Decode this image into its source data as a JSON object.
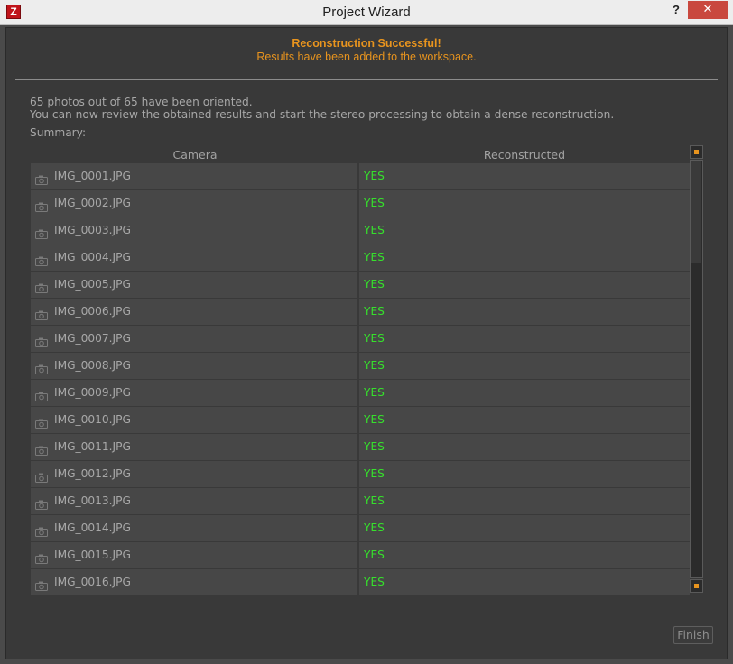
{
  "window": {
    "app_icon": "Z",
    "title": "Project Wizard",
    "help_label": "?",
    "close_label": "✕"
  },
  "header": {
    "title": "Reconstruction Successful!",
    "subtitle": "Results have been added to the workspace."
  },
  "info": {
    "line1": "65 photos out of 65 have been oriented.",
    "line2": "You can now review the obtained results and start the stereo processing to obtain a dense reconstruction.",
    "summary_label": "Summary:"
  },
  "table": {
    "columns": [
      "Camera",
      "Reconstructed"
    ],
    "rows": [
      {
        "camera": "IMG_0001.JPG",
        "reconstructed": "YES"
      },
      {
        "camera": "IMG_0002.JPG",
        "reconstructed": "YES"
      },
      {
        "camera": "IMG_0003.JPG",
        "reconstructed": "YES"
      },
      {
        "camera": "IMG_0004.JPG",
        "reconstructed": "YES"
      },
      {
        "camera": "IMG_0005.JPG",
        "reconstructed": "YES"
      },
      {
        "camera": "IMG_0006.JPG",
        "reconstructed": "YES"
      },
      {
        "camera": "IMG_0007.JPG",
        "reconstructed": "YES"
      },
      {
        "camera": "IMG_0008.JPG",
        "reconstructed": "YES"
      },
      {
        "camera": "IMG_0009.JPG",
        "reconstructed": "YES"
      },
      {
        "camera": "IMG_0010.JPG",
        "reconstructed": "YES"
      },
      {
        "camera": "IMG_0011.JPG",
        "reconstructed": "YES"
      },
      {
        "camera": "IMG_0012.JPG",
        "reconstructed": "YES"
      },
      {
        "camera": "IMG_0013.JPG",
        "reconstructed": "YES"
      },
      {
        "camera": "IMG_0014.JPG",
        "reconstructed": "YES"
      },
      {
        "camera": "IMG_0015.JPG",
        "reconstructed": "YES"
      },
      {
        "camera": "IMG_0016.JPG",
        "reconstructed": "YES"
      }
    ],
    "row_icon": "camera-icon"
  },
  "scrollbar": {
    "visible_fraction": 0.246,
    "position": 0
  },
  "footer": {
    "finish_label": "Finish"
  },
  "colors": {
    "accent": "#e8941e",
    "success": "#36e02c",
    "close_button": "#c9483e"
  }
}
